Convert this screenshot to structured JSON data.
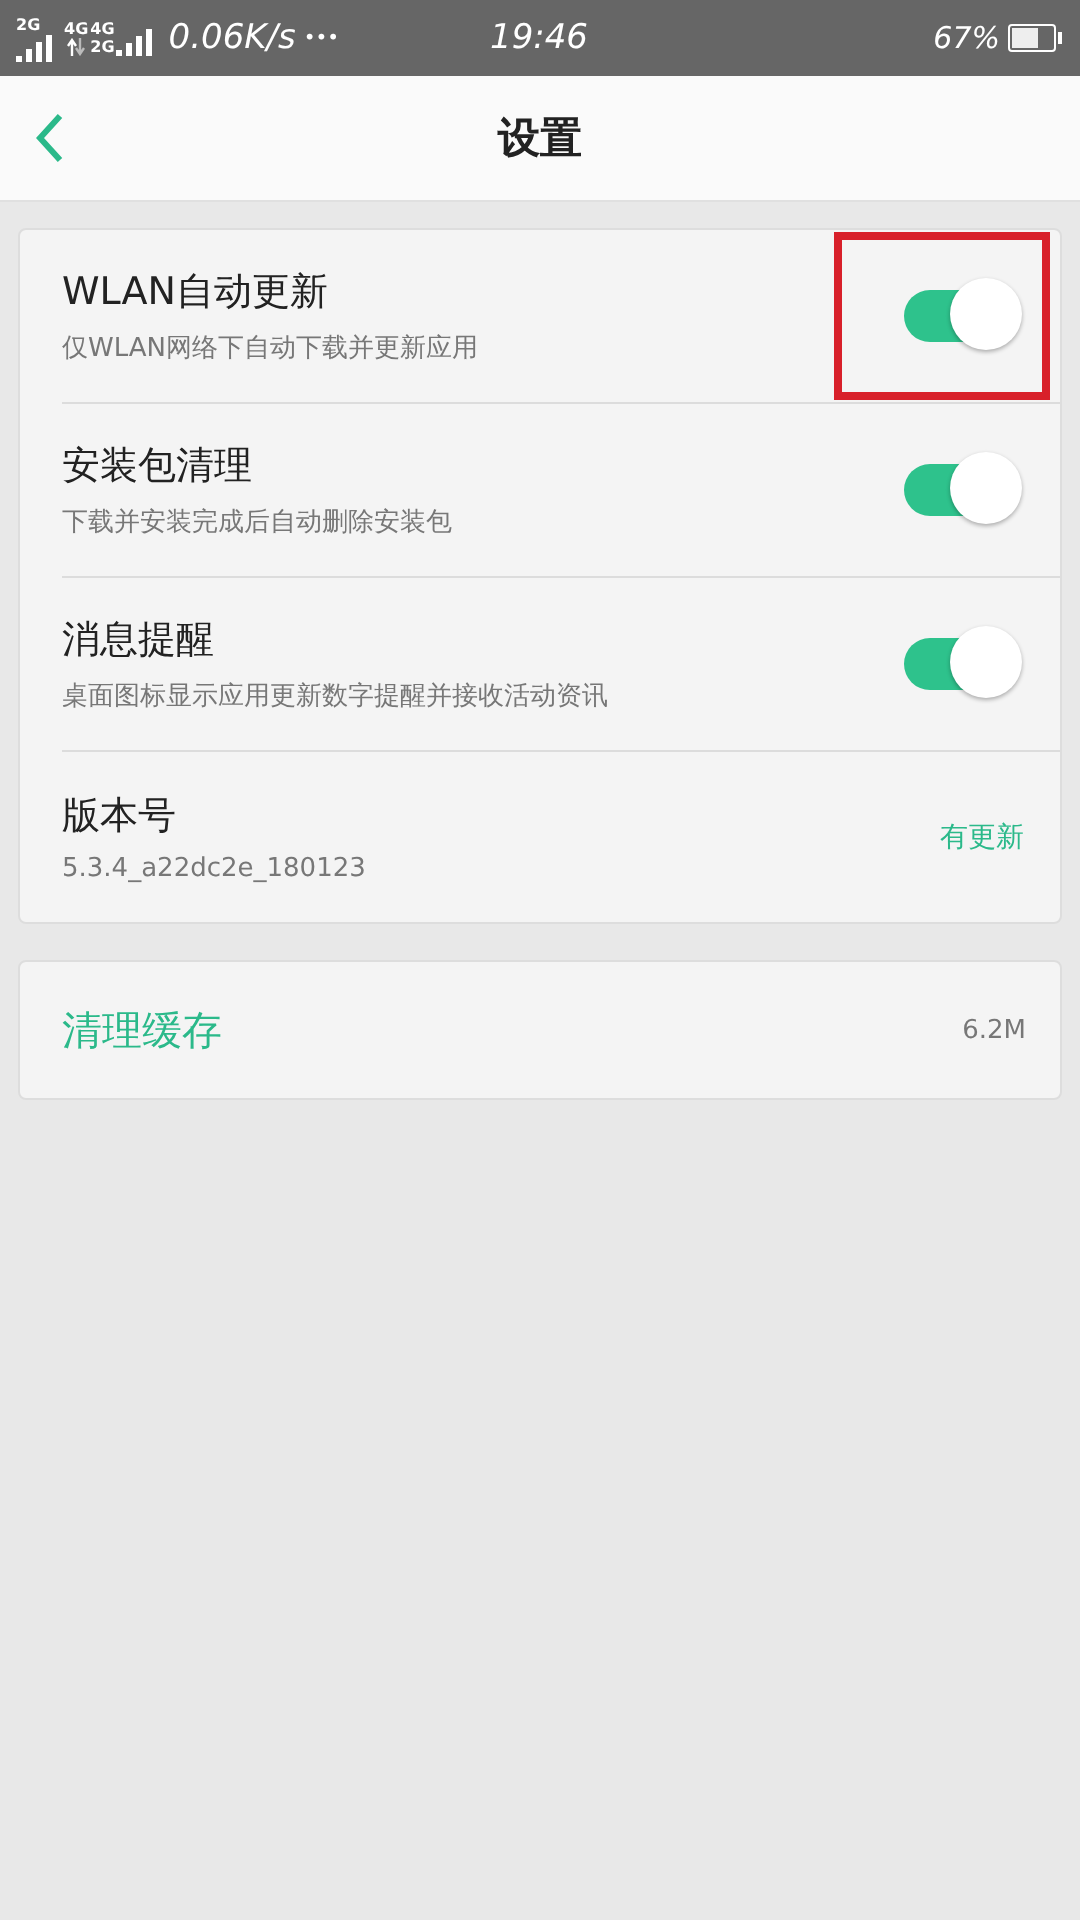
{
  "status_bar": {
    "sim1": "2G",
    "sim2_top": "4G",
    "sim2_left": "4G",
    "sim2_bottom": "2G",
    "speed": "0.06K/s",
    "more": "•••",
    "time": "19:46",
    "battery": "67%"
  },
  "header": {
    "title": "设置"
  },
  "settings": [
    {
      "kind": "toggle",
      "title": "WLAN自动更新",
      "subtitle": "仅WLAN网络下自动下载并更新应用",
      "on": true,
      "highlighted": true
    },
    {
      "kind": "toggle",
      "title": "安装包清理",
      "subtitle": "下载并安装完成后自动删除安装包",
      "on": true,
      "highlighted": false
    },
    {
      "kind": "toggle",
      "title": "消息提醒",
      "subtitle": "桌面图标显示应用更新数字提醒并接收活动资讯",
      "on": true,
      "highlighted": false
    },
    {
      "kind": "info",
      "title": "版本号",
      "subtitle": "5.3.4_a22dc2e_180123",
      "value": "有更新"
    }
  ],
  "cache": {
    "title": "清理缓存",
    "value": "6.2M"
  }
}
